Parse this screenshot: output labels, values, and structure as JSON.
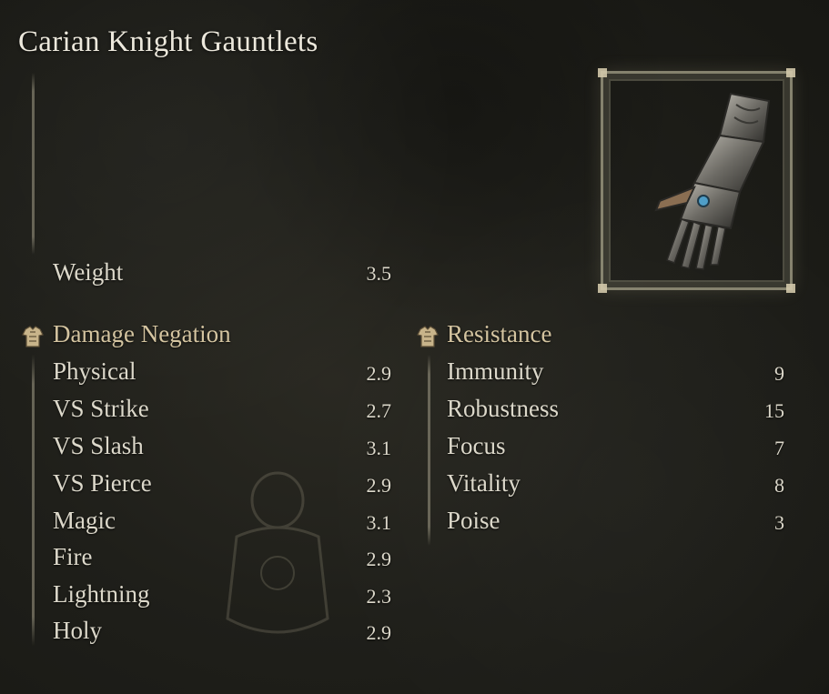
{
  "item": {
    "name": "Carian Knight Gauntlets",
    "weight_label": "Weight",
    "weight_value": "3.5"
  },
  "damage_negation": {
    "header": "Damage Negation",
    "icon": "chest-armor-icon",
    "rows": [
      {
        "label": "Physical",
        "value": "2.9"
      },
      {
        "label": "VS Strike",
        "value": "2.7"
      },
      {
        "label": "VS Slash",
        "value": "3.1"
      },
      {
        "label": "VS Pierce",
        "value": "2.9"
      },
      {
        "label": "Magic",
        "value": "3.1"
      },
      {
        "label": "Fire",
        "value": "2.9"
      },
      {
        "label": "Lightning",
        "value": "2.3"
      },
      {
        "label": "Holy",
        "value": "2.9"
      }
    ]
  },
  "resistance": {
    "header": "Resistance",
    "icon": "chest-armor-icon",
    "rows": [
      {
        "label": "Immunity",
        "value": "9"
      },
      {
        "label": "Robustness",
        "value": "15"
      },
      {
        "label": "Focus",
        "value": "7"
      },
      {
        "label": "Vitality",
        "value": "8"
      },
      {
        "label": "Poise",
        "value": "3"
      }
    ]
  },
  "colors": {
    "text": "#dcd8ca",
    "header": "#d4c4a0",
    "frame": "#aaa58c"
  }
}
